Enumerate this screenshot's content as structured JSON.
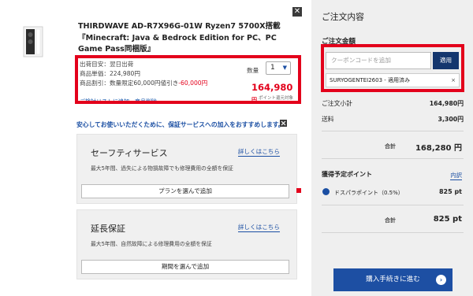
{
  "product": {
    "title": "THIRDWAVE AD-R7X96G-01W Ryzen7 5700X搭載『Minecraft: Java & Bedrock Edition for PC、PC Game Pass同梱版』",
    "ship_label": "出荷目安：翌日出荷",
    "unit_price_label": "商品単価：224,980円",
    "discount_label": "商品割引：数量限定60,000円値引き",
    "discount_value": "-60,000円",
    "qty_label": "数量",
    "qty_value": "1",
    "price": "164,980",
    "price_unit": "円",
    "points_note": "ポイント還元対象",
    "cart_link": "ご検討リストに追加　商品削除"
  },
  "recommendation": "安心してお使いいただくために、保証サービスへの加入をおすすめします。",
  "services": [
    {
      "title": "セーフティサービス",
      "link": "詳しくはこちら",
      "desc": "最大5年間、過失による物損故障でも修理費用の全額を保証",
      "button": "プランを選んで追加"
    },
    {
      "title": "延長保証",
      "link": "詳しくはこちら",
      "desc": "最大5年間、自然故障による修理費用の全額を保証",
      "button": "期間を選んで追加"
    }
  ],
  "order": {
    "heading": "ご注文内容",
    "amount_label": "ご注文金額",
    "coupon_placeholder": "クーポンコードを追加",
    "apply": "適用",
    "applied_coupon": "SURYOGENTEI2603 - 適用済み",
    "remove": "×",
    "subtotal_label": "ご注文小計",
    "subtotal": "164,980円",
    "shipping_label": "送料",
    "shipping": "3,300円",
    "total_label": "合計",
    "total": "168,280 円",
    "points_heading": "獲得予定ポイント",
    "detail_link": "内訳",
    "dp_label": "ドスパラポイント（0.5%）",
    "dp_value": "825 pt",
    "points_total_label": "合計",
    "points_total": "825 pt",
    "checkout": "購入手続きに進む"
  },
  "colors": {
    "accent_red": "#e3001b",
    "brand_blue": "#1d4fa3",
    "apply_navy": "#14366e"
  }
}
